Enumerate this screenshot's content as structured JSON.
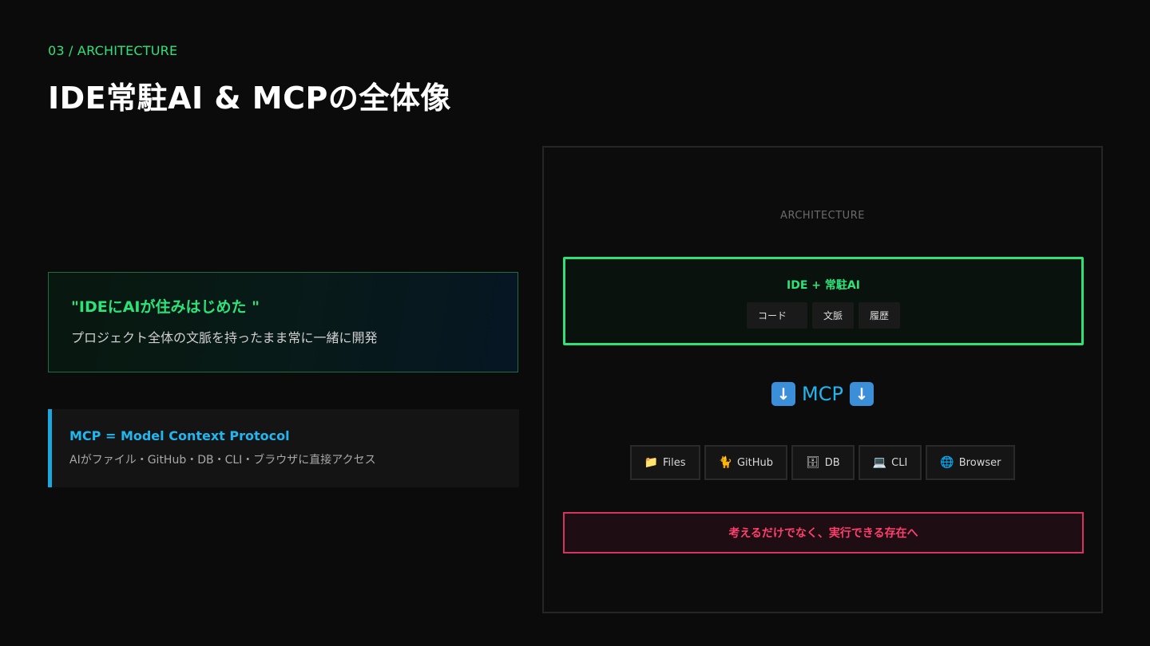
{
  "header": {
    "eyebrow": "03 / ARCHITECTURE",
    "title": "IDE常駐AI & MCPの全体像"
  },
  "quote_card": {
    "title": "\"IDEにAIが住みはじめた \"",
    "subtitle": "プロジェクト全体の文脈を持ったまま常に一緒に開発"
  },
  "mcp_card": {
    "title": "MCP = Model Context Protocol",
    "subtitle": "AIがファイル・GitHub・DB・CLI・ブラウザに直接アクセス"
  },
  "architecture": {
    "label": "ARCHITECTURE",
    "ide_box": {
      "title": "IDE + 常駐AI",
      "chips": [
        "コード",
        "文脈",
        "履歴"
      ]
    },
    "arrow": {
      "text": "MCP",
      "icon": "down-arrow-icon",
      "icon_glyph": "↓"
    },
    "tools": [
      {
        "label": "Files",
        "icon": "folder-icon",
        "glyph": "📁"
      },
      {
        "label": "GitHub",
        "icon": "cat-icon",
        "glyph": "🐈"
      },
      {
        "label": "DB",
        "icon": "database-icon",
        "glyph": "🗄"
      },
      {
        "label": "CLI",
        "icon": "laptop-icon",
        "glyph": "💻"
      },
      {
        "label": "Browser",
        "icon": "globe-icon",
        "glyph": "🌐"
      }
    ],
    "bottom_text": "考えるだけでなく、実行できる存在へ"
  },
  "colors": {
    "accent_green": "#2ee27a",
    "accent_blue": "#22b6f0",
    "accent_red": "#ff3f6e",
    "background": "#0b0b0b"
  }
}
